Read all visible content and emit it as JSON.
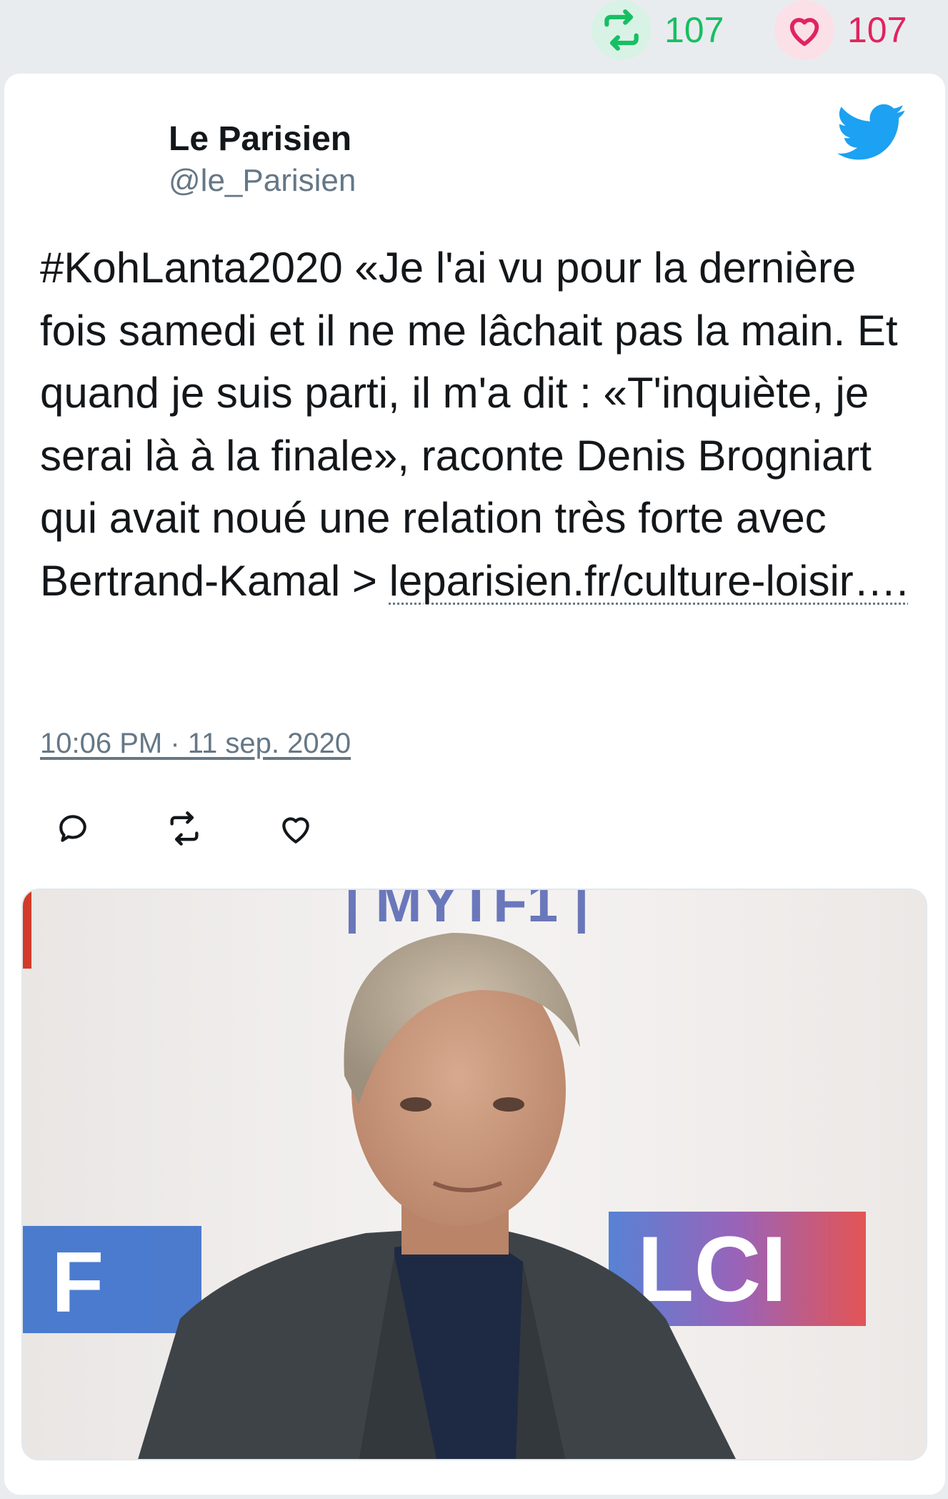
{
  "stats": {
    "retweets": "107",
    "likes": "107",
    "retweet_icon": "retweet-icon",
    "like_icon": "heart-icon",
    "retweet_color": "#17bf63",
    "like_color": "#e0245e"
  },
  "author": {
    "name": "Le Parisien",
    "handle": "@le_Parisien"
  },
  "tweet": {
    "text": "#KohLanta2020 «Je l'ai vu pour la dernière fois samedi et il ne me lâchait pas la main. Et quand je suis parti, il m'a dit : «T'inquiète, je serai là à la finale», raconte Denis Brogniart qui avait noué une relation très forte avec Bertrand-Kamal > ",
    "link": "leparisien.fr/culture-loisir….",
    "timestamp": "10:06 PM · 11 sep. 2020"
  },
  "media": {
    "backdrop_logo_top": "| MYTF1 |",
    "backdrop_logo_left": "F",
    "backdrop_logo_right": "LCI"
  },
  "colors": {
    "twitter_blue": "#1da1f2",
    "text": "#14171a",
    "secondary": "#657786"
  }
}
